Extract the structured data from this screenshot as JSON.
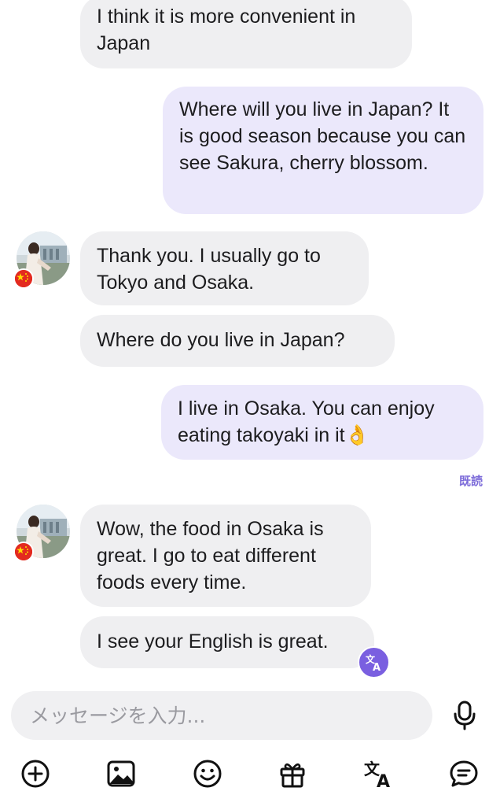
{
  "messages": [
    {
      "direction": "in",
      "text": "I think it is more convenient in Japan"
    },
    {
      "direction": "out",
      "text": "Where will you live in Japan? It is good season because you can see Sakura, cherry blossom."
    },
    {
      "direction": "in",
      "text": "Thank you. I usually go to Tokyo and Osaka."
    },
    {
      "direction": "in",
      "text": "Where do you live in Japan?"
    },
    {
      "direction": "out",
      "text": "I live in Osaka. You can enjoy eating takoyaki in it",
      "emoji": "👌"
    },
    {
      "direction": "in",
      "text": "Wow, the food in Osaka is great. I go to eat different foods every time."
    },
    {
      "direction": "in",
      "text": "I see your English is great."
    }
  ],
  "read_receipt": "既読",
  "composer": {
    "placeholder": "メッセージを入力..."
  },
  "icons": {
    "mic": "microphone-icon",
    "toolbar": [
      "plus-circle-icon",
      "image-icon",
      "emoji-icon",
      "gift-icon",
      "translate-icon",
      "chat-bubble-icon"
    ],
    "translate_badge": "translate-icon",
    "flag": "china-flag-icon"
  },
  "colors": {
    "incoming_bubble": "#efeff1",
    "outgoing_bubble": "#ebe8fb",
    "accent": "#7a5fe0",
    "read_receipt": "#7c6bd9"
  }
}
